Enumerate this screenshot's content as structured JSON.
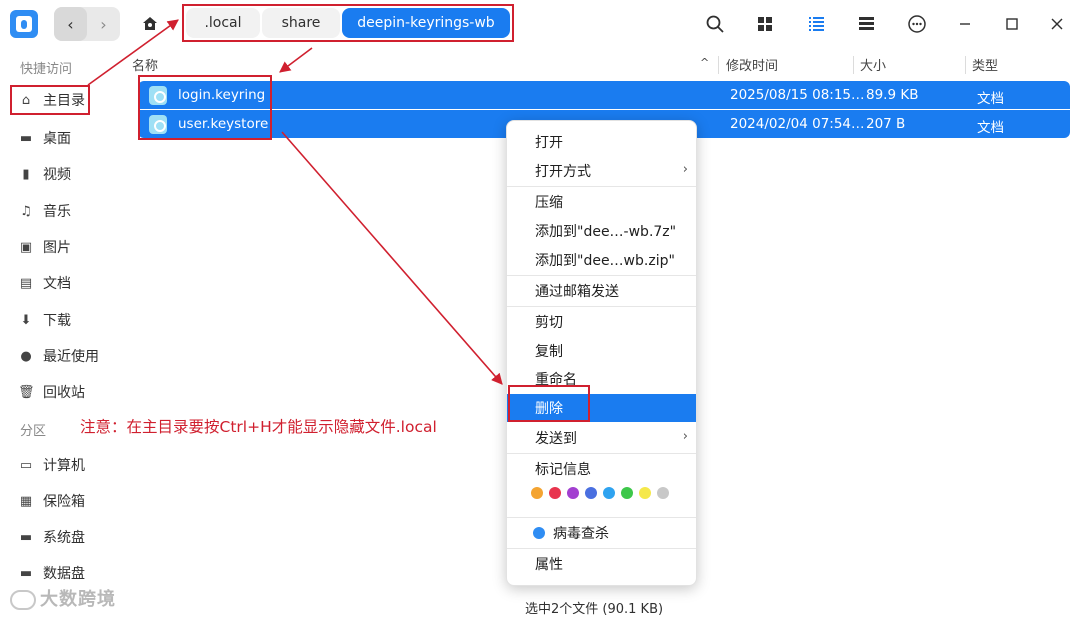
{
  "toolbar": {
    "breadcrumbs": [
      ".local",
      "share",
      "deepin-keyrings-wb"
    ]
  },
  "sidebar": {
    "quick_access_label": "快捷访问",
    "quick_items": [
      "主目录",
      "桌面",
      "视频",
      "音乐",
      "图片",
      "文档",
      "下载",
      "最近使用",
      "回收站"
    ],
    "partition_label": "分区",
    "partition_items": [
      "计算机",
      "保险箱",
      "系统盘",
      "数据盘"
    ]
  },
  "columns": {
    "name": "名称",
    "modified": "修改时间",
    "size": "大小",
    "type": "类型"
  },
  "files": [
    {
      "name": "login.keyring",
      "modified": "2025/08/15 08:15…",
      "size": "89.9 KB",
      "type": "文档"
    },
    {
      "name": "user.keystore",
      "modified": "2024/02/04 07:54…",
      "size": "207 B",
      "type": "文档"
    }
  ],
  "context_menu": {
    "items": [
      "打开",
      "打开方式",
      "压缩",
      "添加到\"dee…-wb.7z\"",
      "添加到\"dee…wb.zip\"",
      "通过邮箱发送",
      "剪切",
      "复制",
      "重命名",
      "删除",
      "发送到",
      "标记信息",
      "病毒查杀",
      "属性"
    ],
    "tag_colors": [
      "#f4a431",
      "#e8344e",
      "#a23fd0",
      "#4a6fe0",
      "#2fa3f0",
      "#3dc74a",
      "#f5e84a",
      "#c8c8c8"
    ]
  },
  "annotation_note": "注意：在主目录要按Ctrl+H才能显示隐藏文件.local",
  "status_bar": "选中2个文件 (90.1 KB)",
  "watermark": "大数跨境",
  "colors": {
    "accent": "#1a7cf0",
    "annotation": "#d0202f"
  }
}
